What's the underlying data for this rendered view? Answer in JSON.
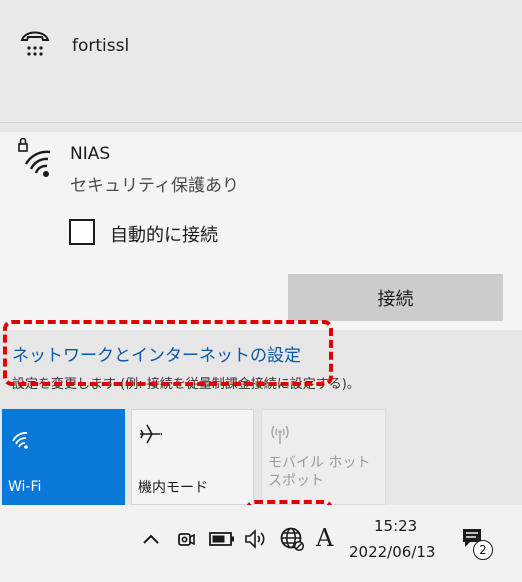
{
  "networks": [
    {
      "name": "fortissl",
      "icon": "dialup-network-icon"
    },
    {
      "name": "NIAS",
      "status": "セキュリティ保護あり",
      "icon": "wifi-secured-icon"
    }
  ],
  "auto_connect": {
    "label": "自動的に接続",
    "checked": false
  },
  "connect_button": "接続",
  "settings": {
    "link": "ネットワークとインターネットの設定",
    "description": "設定を変更します (例: 接続を従量制課金接続に設定する)。"
  },
  "quick_actions": [
    {
      "label": "Wi-Fi",
      "active": true,
      "icon": "wifi-icon"
    },
    {
      "label": "機内モード",
      "active": false,
      "icon": "airplane-icon"
    },
    {
      "label": "モバイル ホットスポット",
      "active": false,
      "disabled": true,
      "icon": "hotspot-icon"
    }
  ],
  "taskbar": {
    "time": "15:23",
    "date": "2022/06/13",
    "ime": "A",
    "notification_count": "2"
  },
  "colors": {
    "accent": "#0a78d7",
    "highlight": "#e00000",
    "link": "#0b57a8"
  }
}
